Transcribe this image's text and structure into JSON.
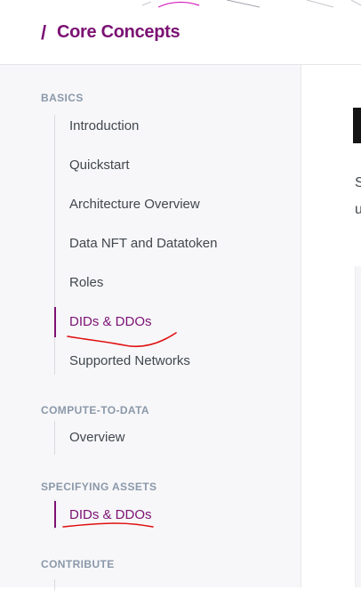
{
  "header": {
    "breadcrumb_separator": "/",
    "title": "Core Concepts"
  },
  "sidebar": {
    "sections": [
      {
        "title": "BASICS",
        "items": [
          {
            "label": "Introduction"
          },
          {
            "label": "Quickstart"
          },
          {
            "label": "Architecture Overview"
          },
          {
            "label": "Data NFT and Datatoken"
          },
          {
            "label": "Roles"
          },
          {
            "label": "DIDs & DDOs"
          },
          {
            "label": "Supported Networks"
          }
        ]
      },
      {
        "title": "COMPUTE-TO-DATA",
        "items": [
          {
            "label": "Overview"
          }
        ]
      },
      {
        "title": "SPECIFYING ASSETS",
        "items": [
          {
            "label": "DIDs & DDOs"
          }
        ]
      },
      {
        "title": "CONTRIBUTE",
        "items": []
      }
    ]
  },
  "content": {
    "paragraph_fragments": [
      "S",
      "u"
    ]
  },
  "colors": {
    "accent": "#7b1173",
    "section_title": "#8b98a9",
    "nav_text": "#41474e",
    "annotation": "#e01010"
  }
}
